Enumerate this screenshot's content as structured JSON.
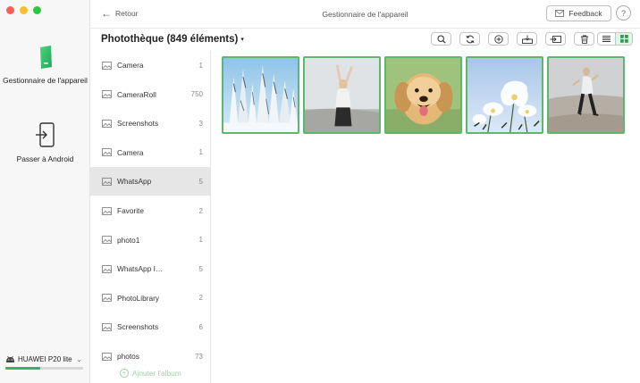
{
  "sidebar": {
    "nav": [
      {
        "label": "Gestionnaire de l'appareil",
        "icon": "phone-manager-icon",
        "active": true
      },
      {
        "label": "Passer à Android",
        "icon": "switch-android-icon",
        "active": false
      }
    ],
    "device": {
      "name": "HUAWEI P20 lite",
      "icon": "android-icon",
      "storage_used_fraction": 0.45
    }
  },
  "topbar": {
    "back_label": "Retour",
    "title": "Gestionnaire de l'appareil",
    "feedback_label": "Feedback",
    "help_label": "?"
  },
  "header": {
    "title": "Photothèque (849 éléments)",
    "toolbar": [
      "search-icon",
      "refresh-icon",
      "add-icon",
      "export-to-computer-icon",
      "export-to-device-icon",
      "delete-icon"
    ],
    "view_mode": "grid"
  },
  "albums": {
    "items": [
      {
        "name": "Camera",
        "count": "1"
      },
      {
        "name": "CameraRoll",
        "count": "750"
      },
      {
        "name": "Screenshots",
        "count": "3"
      },
      {
        "name": "Camera",
        "count": "1"
      },
      {
        "name": "WhatsApp",
        "count": "5"
      },
      {
        "name": "Favorite",
        "count": "2"
      },
      {
        "name": "photo1",
        "count": "1"
      },
      {
        "name": "WhatsApp I…",
        "count": "5"
      },
      {
        "name": "PhotoLibrary",
        "count": "2"
      },
      {
        "name": "Screenshots",
        "count": "6"
      },
      {
        "name": "photos",
        "count": "73"
      }
    ],
    "selected_index": 4,
    "add_label": "Ajouter l'album"
  },
  "colors": {
    "accent": "#5cb86e",
    "selected_row": "#e6e6e6"
  },
  "photos": [
    {
      "subject": "snowy-forest-photo"
    },
    {
      "subject": "woman-sky-photo"
    },
    {
      "subject": "golden-retriever-photo"
    },
    {
      "subject": "white-flowers-photo"
    },
    {
      "subject": "woman-beach-photo"
    }
  ]
}
